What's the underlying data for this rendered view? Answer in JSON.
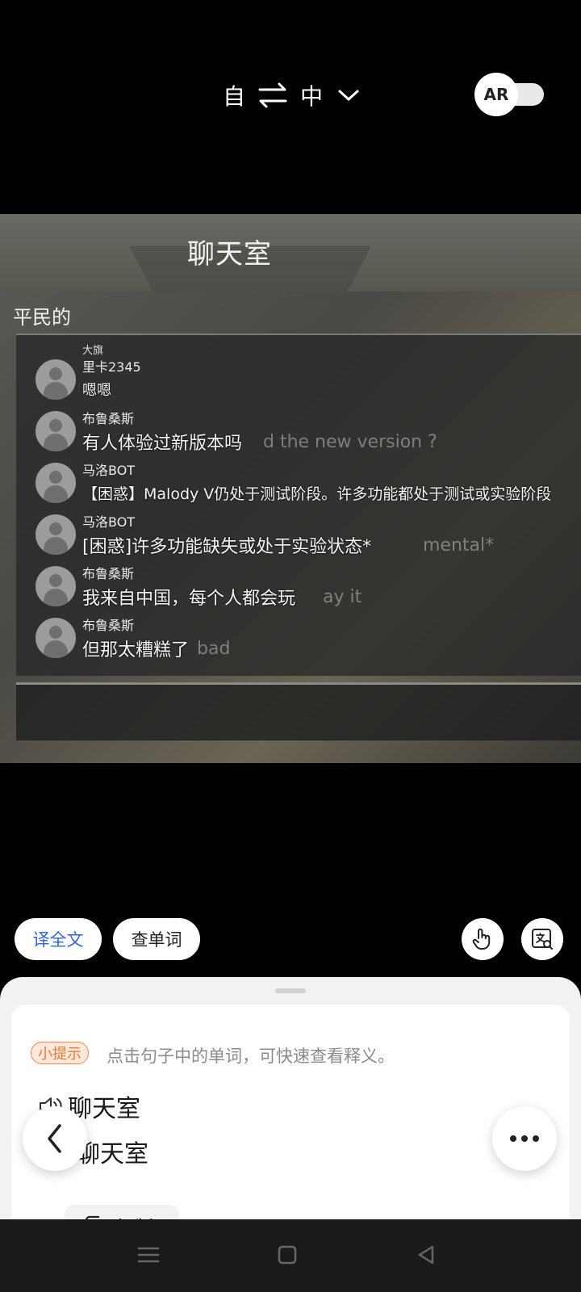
{
  "top": {
    "source_lang": "自",
    "target_lang": "中",
    "ar_label": "AR"
  },
  "camera": {
    "title": "聊天室",
    "subtitle": "平民的",
    "messages": [
      {
        "user": "里卡2345",
        "text": "嗯嗯",
        "ghost": ""
      },
      {
        "user": "布鲁桑斯",
        "text": "有人体验过新版本吗",
        "ghost": "d the new version ?"
      },
      {
        "user": "马洛BOT",
        "text": "【困惑】Malody V仍处于测试阶段。许多功能都处于测试或实验阶段",
        "ghost": ""
      },
      {
        "user": "马洛BOT",
        "text": "[困惑]许多功能缺失或处于实验状态*",
        "ghost": "mental*"
      },
      {
        "user": "布鲁桑斯",
        "text": "我来自中国，每个人都会玩",
        "ghost": "ay it"
      },
      {
        "user": "布鲁桑斯",
        "text": "但那太糟糕了",
        "ghost": "bad"
      }
    ],
    "top_snippet": "大旗"
  },
  "actions": {
    "translate_all": "译全文",
    "lookup_word": "查单词"
  },
  "sheet": {
    "tip_badge": "小提示",
    "tip_text": "点击句子中的单词，可快速查看释义。",
    "source_text": "聊天室",
    "translated_text": "聊天室",
    "copy_label": "复制"
  },
  "colors": {
    "accent": "#2f63d8",
    "tip": "#ea7a36"
  }
}
